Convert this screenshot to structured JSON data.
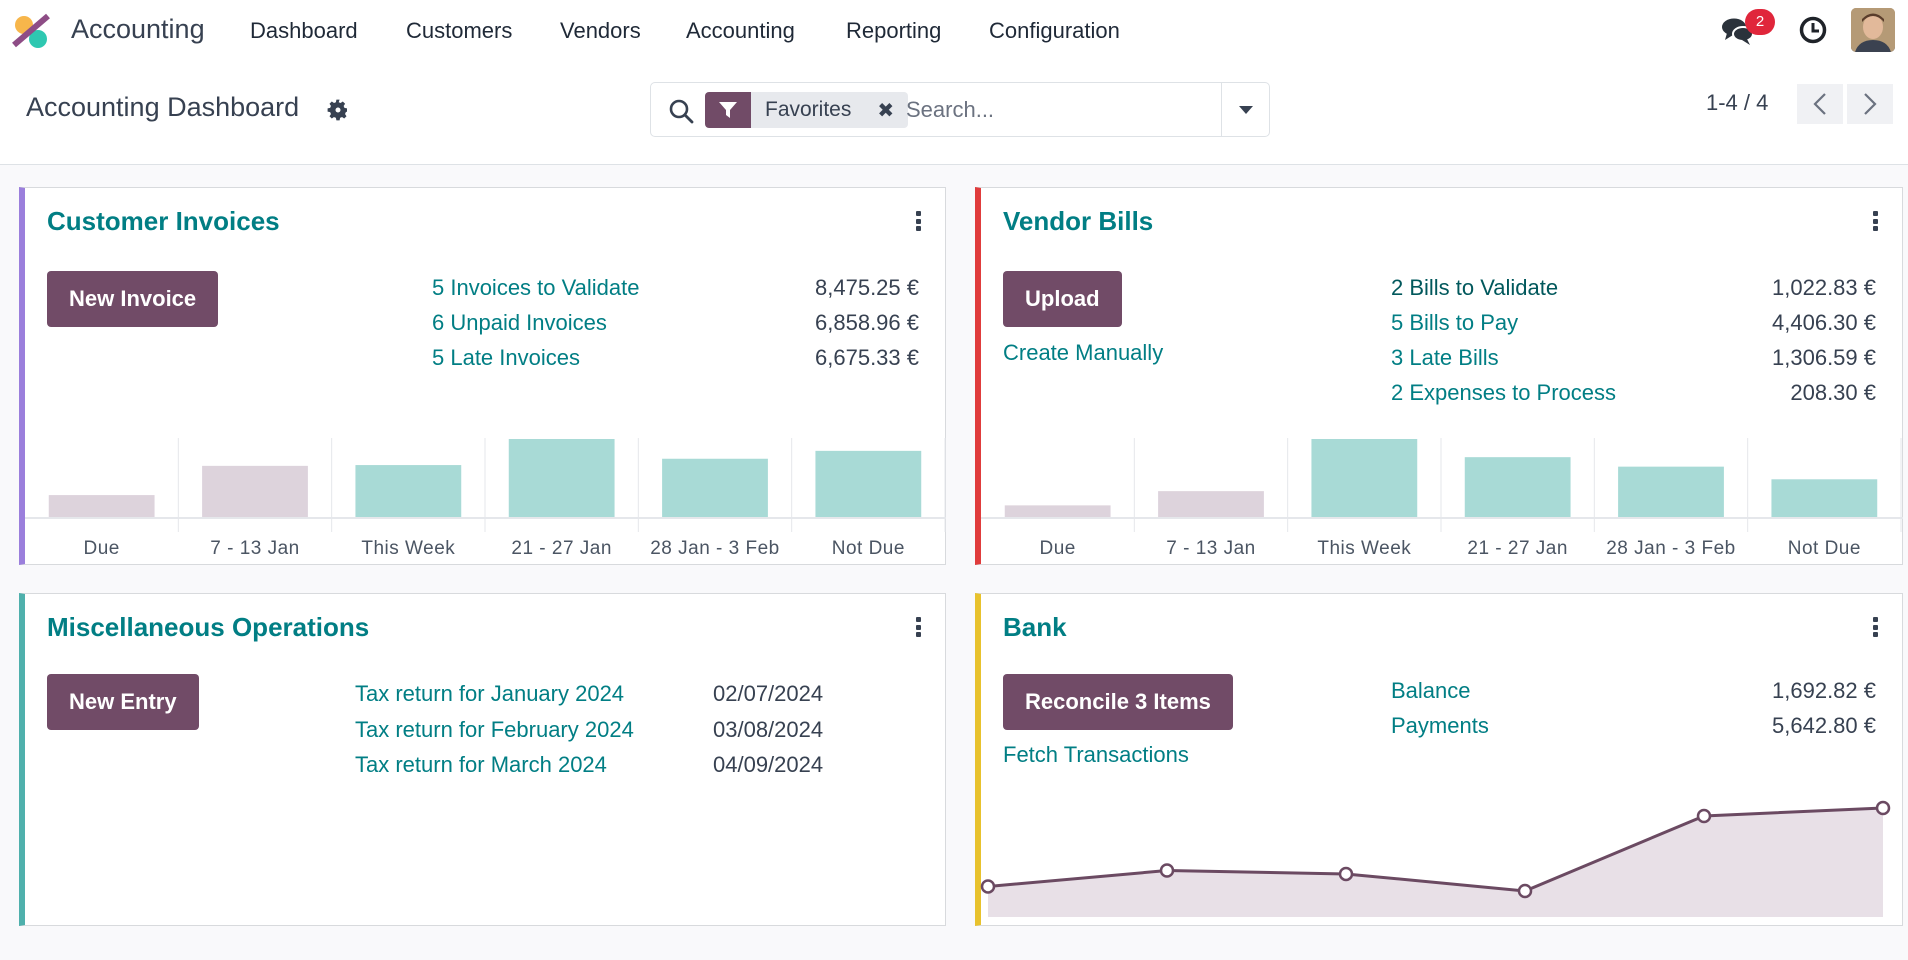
{
  "navbar": {
    "app_name": "Accounting",
    "menu": [
      "Dashboard",
      "Customers",
      "Vendors",
      "Accounting",
      "Reporting",
      "Configuration"
    ],
    "messages_badge": "2",
    "icons": [
      "messages-icon",
      "activity-clock-icon",
      "user-avatar"
    ]
  },
  "control_panel": {
    "title": "Accounting Dashboard",
    "search": {
      "facet_label": "Favorites",
      "facet_icon": "filter-icon",
      "placeholder": "Search..."
    },
    "pager": "1-4 / 4"
  },
  "colors": {
    "brand": "#714b67",
    "link": "#017e84",
    "bar_past": "#ddd3dc",
    "bar_future": "#a8dad6",
    "customer_invoices_accent": "#9b7fdc",
    "vendor_bills_accent": "#e03c3c",
    "misc_accent": "#4fb0ac",
    "bank_accent": "#e8c22d"
  },
  "cards": {
    "customer_invoices": {
      "title": "Customer Invoices",
      "button": "New Invoice",
      "rows": [
        {
          "label": "5 Invoices to Validate",
          "value": "8,475.25 €"
        },
        {
          "label": "6 Unpaid Invoices",
          "value": "6,858.96 €"
        },
        {
          "label": "5 Late Invoices",
          "value": "6,675.33 €"
        }
      ]
    },
    "vendor_bills": {
      "title": "Vendor Bills",
      "button": "Upload",
      "secondary_link": "Create Manually",
      "rows": [
        {
          "label": "2 Bills to Validate",
          "value": "1,022.83 €"
        },
        {
          "label": "5 Bills to Pay",
          "value": "4,406.30 €"
        },
        {
          "label": "3 Late Bills",
          "value": "1,306.59 €"
        },
        {
          "label": "2 Expenses to Process",
          "value": "208.30 €"
        }
      ]
    },
    "misc_operations": {
      "title": "Miscellaneous Operations",
      "button": "New Entry",
      "rows": [
        {
          "label": "Tax return for January 2024",
          "value": "02/07/2024"
        },
        {
          "label": "Tax return for February 2024",
          "value": "03/08/2024"
        },
        {
          "label": "Tax return for March 2024",
          "value": "04/09/2024"
        }
      ]
    },
    "bank": {
      "title": "Bank",
      "button": "Reconcile 3 Items",
      "secondary_link": "Fetch Transactions",
      "rows": [
        {
          "label": "Balance",
          "value": "1,692.82 €"
        },
        {
          "label": "Payments",
          "value": "5,642.80 €"
        }
      ]
    }
  },
  "chart_data": [
    {
      "type": "bar",
      "title": "Customer Invoices",
      "categories": [
        "Due",
        "7 - 13 Jan",
        "This Week",
        "21 - 27 Jan",
        "28 Jan - 3 Feb",
        "Not Due"
      ],
      "values": [
        29,
        66,
        67,
        100,
        75,
        85
      ],
      "past": [
        true,
        true,
        false,
        false,
        false,
        false
      ],
      "ylim": [
        0,
        100
      ],
      "xlabel": "",
      "ylabel": "",
      "grid": false
    },
    {
      "type": "bar",
      "title": "Vendor Bills",
      "categories": [
        "Due",
        "7 - 13 Jan",
        "This Week",
        "21 - 27 Jan",
        "28 Jan - 3 Feb",
        "Not Due"
      ],
      "values": [
        16,
        34,
        100,
        77,
        65,
        49
      ],
      "past": [
        true,
        true,
        false,
        false,
        false,
        false
      ],
      "ylim": [
        0,
        100
      ],
      "xlabel": "",
      "ylabel": "",
      "grid": false
    },
    {
      "type": "area",
      "title": "Bank",
      "x": [
        1,
        2,
        3,
        4,
        5,
        6
      ],
      "values": [
        31,
        45,
        42,
        27,
        93,
        100
      ],
      "ylim": [
        0,
        100
      ],
      "xlabel": "",
      "ylabel": "",
      "grid": false
    }
  ]
}
